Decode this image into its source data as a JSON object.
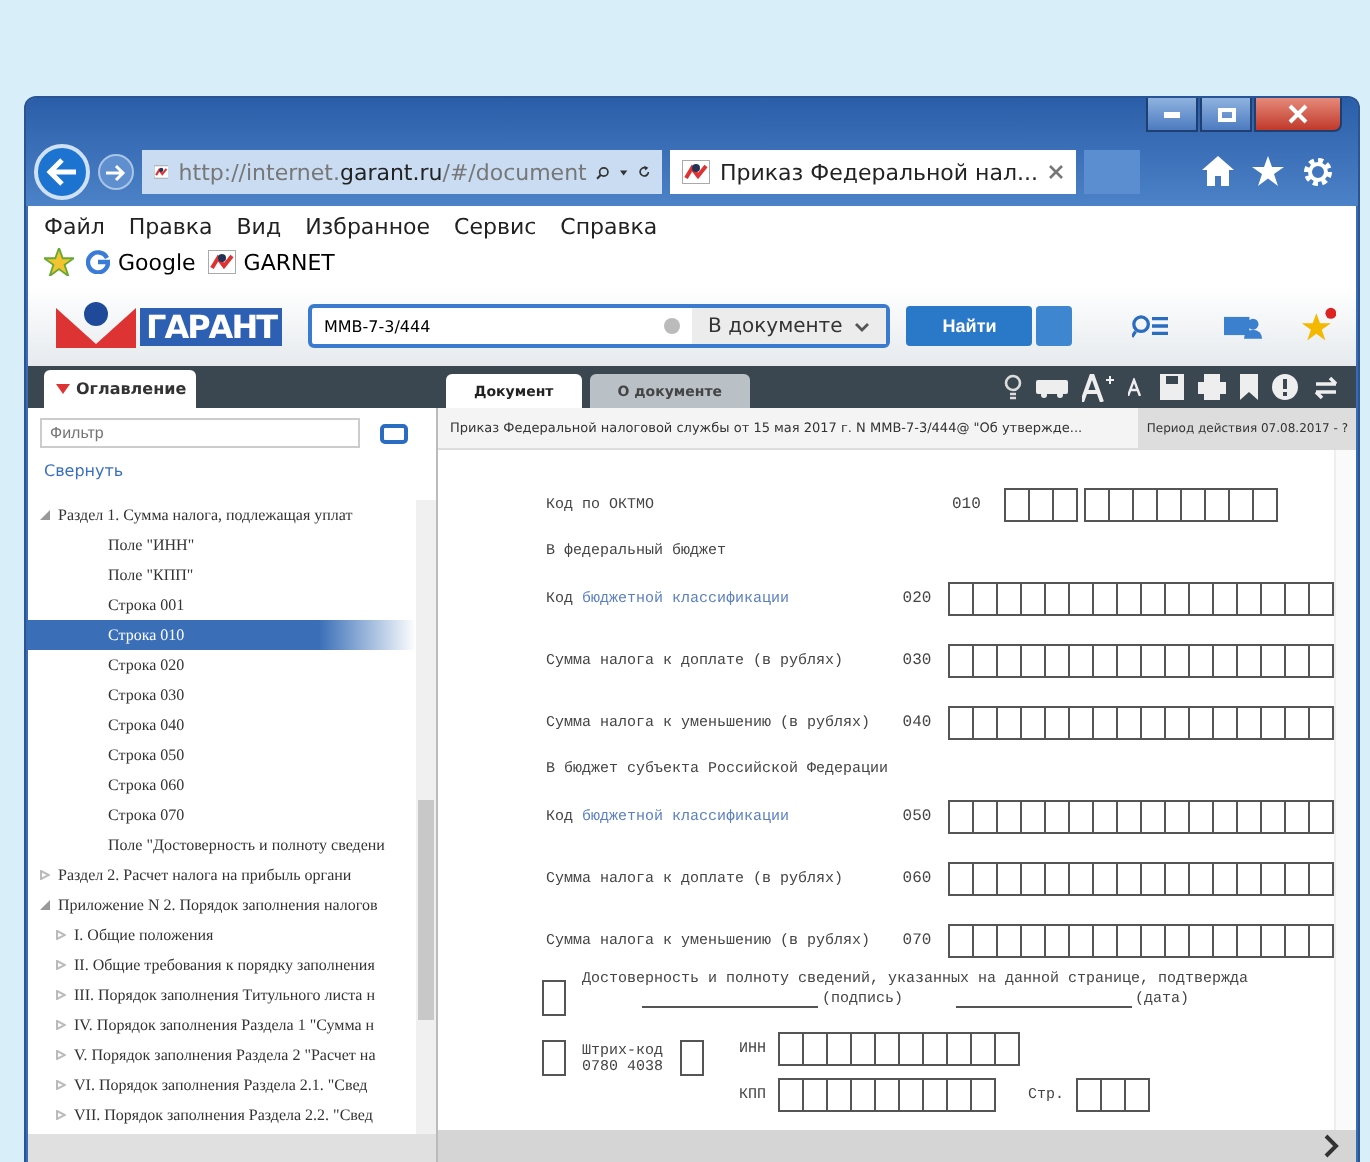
{
  "browser": {
    "address": "http://internet.**garant.ru**/#/document",
    "tab_title": "Приказ Федеральной нал...",
    "menu": [
      "Файл",
      "Правка",
      "Вид",
      "Избранное",
      "Сервис",
      "Справка"
    ],
    "favorites": [
      "Google",
      "GARNET"
    ]
  },
  "toolbar": {
    "logo_text": "ГАРАНТ",
    "search_value": "ММВ-7-3/444",
    "scope": "В документе",
    "find_button": "Найти"
  },
  "sidebar": {
    "tab": "Оглавление",
    "filter_placeholder": "Фильтр",
    "collapse_link": "Свернуть",
    "tree": [
      {
        "label": "Раздел 1. Сумма налога, подлежащая уплат",
        "expanded": true,
        "selected": false,
        "children": [
          {
            "label": "Поле \"ИНН\"",
            "selected": false
          },
          {
            "label": "Поле \"КПП\"",
            "selected": false
          },
          {
            "label": "Строка 001",
            "selected": false
          },
          {
            "label": "Строка 010",
            "selected": true
          },
          {
            "label": "Строка 020",
            "selected": false
          },
          {
            "label": "Строка 030",
            "selected": false
          },
          {
            "label": "Строка 040",
            "selected": false
          },
          {
            "label": "Строка 050",
            "selected": false
          },
          {
            "label": "Строка 060",
            "selected": false
          },
          {
            "label": "Строка 070",
            "selected": false
          },
          {
            "label": "Поле \"Достоверность и полноту сведени",
            "selected": false
          }
        ]
      },
      {
        "label": "Раздел 2. Расчет налога на прибыль органи",
        "expanded": false,
        "selected": false
      },
      {
        "label": "Приложение N 2. Порядок заполнения налогов",
        "expanded": true,
        "selected": false,
        "children": [
          {
            "label": "I. Общие положения",
            "expanded": false,
            "selected": false
          },
          {
            "label": "II. Общие требования к порядку заполнения",
            "expanded": false,
            "selected": false
          },
          {
            "label": "III. Порядок заполнения Титульного листа н",
            "expanded": false,
            "selected": false
          },
          {
            "label": "IV. Порядок заполнения Раздела 1 \"Сумма н",
            "expanded": false,
            "selected": false
          },
          {
            "label": "V. Порядок заполнения Раздела 2 \"Расчет на",
            "expanded": false,
            "selected": false
          },
          {
            "label": "VI. Порядок заполнения Раздела 2.1. \"Свед",
            "expanded": false,
            "selected": false
          },
          {
            "label": "VII. Порядок заполнения Раздела 2.2. \"Свед",
            "expanded": false,
            "selected": false
          }
        ]
      }
    ]
  },
  "document": {
    "tabs": [
      {
        "label": "Документ",
        "selected": true
      },
      {
        "label": "О документе",
        "selected": false
      }
    ],
    "title": "Приказ Федеральной налоговой службы от 15 мая 2017 г. N ММВ-7-3/444@ \"Об утвержде...",
    "period": "Период действия 07.08.2017 - ?",
    "rows": [
      {
        "kind": "okmo",
        "label": "Код по ОКТМО",
        "code": "010"
      },
      {
        "kind": "heading",
        "label": "В федеральный бюджет"
      },
      {
        "kind": "field",
        "label": "Код",
        "link": "бюджетной классификации",
        "code": "020"
      },
      {
        "kind": "field",
        "label": "Сумма налога к доплате (в рублях)",
        "code": "030"
      },
      {
        "kind": "field",
        "label": "Сумма налога к уменьшению (в рублях)",
        "code": "040"
      },
      {
        "kind": "heading",
        "label": "В бюджет субъекта Российской Федерации"
      },
      {
        "kind": "field",
        "label": "Код",
        "link": "бюджетной классификации",
        "code": "050"
      },
      {
        "kind": "field",
        "label": "Сумма налога к доплате (в рублях)",
        "code": "060"
      },
      {
        "kind": "field",
        "label": "Сумма налога к уменьшению (в рублях)",
        "code": "070"
      }
    ],
    "confirmation": "Достоверность и полноту сведений, указанных на данной странице, подтвержда",
    "signature": "(подпись)",
    "date": "(дата)",
    "barcode_label": "Штрих-код",
    "barcode_number": "0780 4038",
    "inn_label": "ИНН",
    "kpp_label": "КПП",
    "page_label": "Стр."
  }
}
